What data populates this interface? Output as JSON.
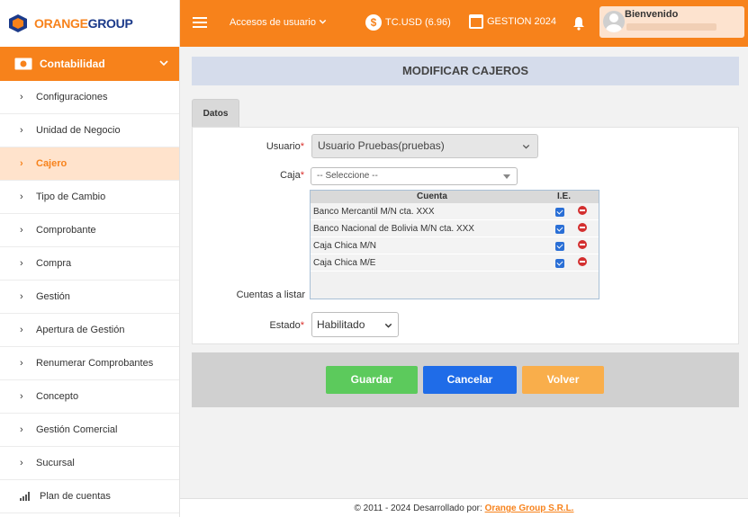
{
  "logo": {
    "part1": "ORANGE",
    "part2": "GROUP"
  },
  "sidebar": {
    "section": "Contabilidad",
    "items": [
      {
        "label": "Configuraciones"
      },
      {
        "label": "Unidad de Negocio"
      },
      {
        "label": "Cajero"
      },
      {
        "label": "Tipo de Cambio"
      },
      {
        "label": "Comprobante"
      },
      {
        "label": "Compra"
      },
      {
        "label": "Gestión"
      },
      {
        "label": "Apertura de Gestión"
      },
      {
        "label": "Renumerar Comprobantes"
      },
      {
        "label": "Concepto"
      },
      {
        "label": "Gestión Comercial"
      },
      {
        "label": "Sucursal"
      },
      {
        "label": "Plan de cuentas"
      }
    ],
    "active_item": "Cajero"
  },
  "topbar": {
    "accesos": "Accesos de usuario",
    "tc": "TC.USD (6.96)",
    "gestion": "GESTION 2024",
    "welcome": "Bienvenido"
  },
  "page": {
    "title": "MODIFICAR CAJEROS",
    "tab": "Datos"
  },
  "form": {
    "usuario_label": "Usuario",
    "usuario_value": "Usuario Pruebas(pruebas)",
    "caja_label": "Caja",
    "caja_value": "-- Seleccione --",
    "cuentas_label": "Cuentas a listar",
    "estado_label": "Estado",
    "estado_value": "Habilitado",
    "required_mark": "*"
  },
  "accounts": {
    "col_cuenta": "Cuenta",
    "col_ie": "I.E.",
    "rows": [
      {
        "name": "Banco Mercantil M/N cta. XXX"
      },
      {
        "name": "Banco Nacional de Bolivia M/N cta. XXX"
      },
      {
        "name": "Caja Chica M/N"
      },
      {
        "name": "Caja Chica M/E"
      }
    ]
  },
  "buttons": {
    "save": "Guardar",
    "cancel": "Cancelar",
    "back": "Volver"
  },
  "footer": {
    "text": "© 2011 - 2024 Desarrollado por: ",
    "brand": "Orange Group S.R.L."
  },
  "colors": {
    "accent": "#f7821b",
    "save": "#5cca5c",
    "cancel": "#1f6ce8",
    "back": "#f9ae4b"
  }
}
